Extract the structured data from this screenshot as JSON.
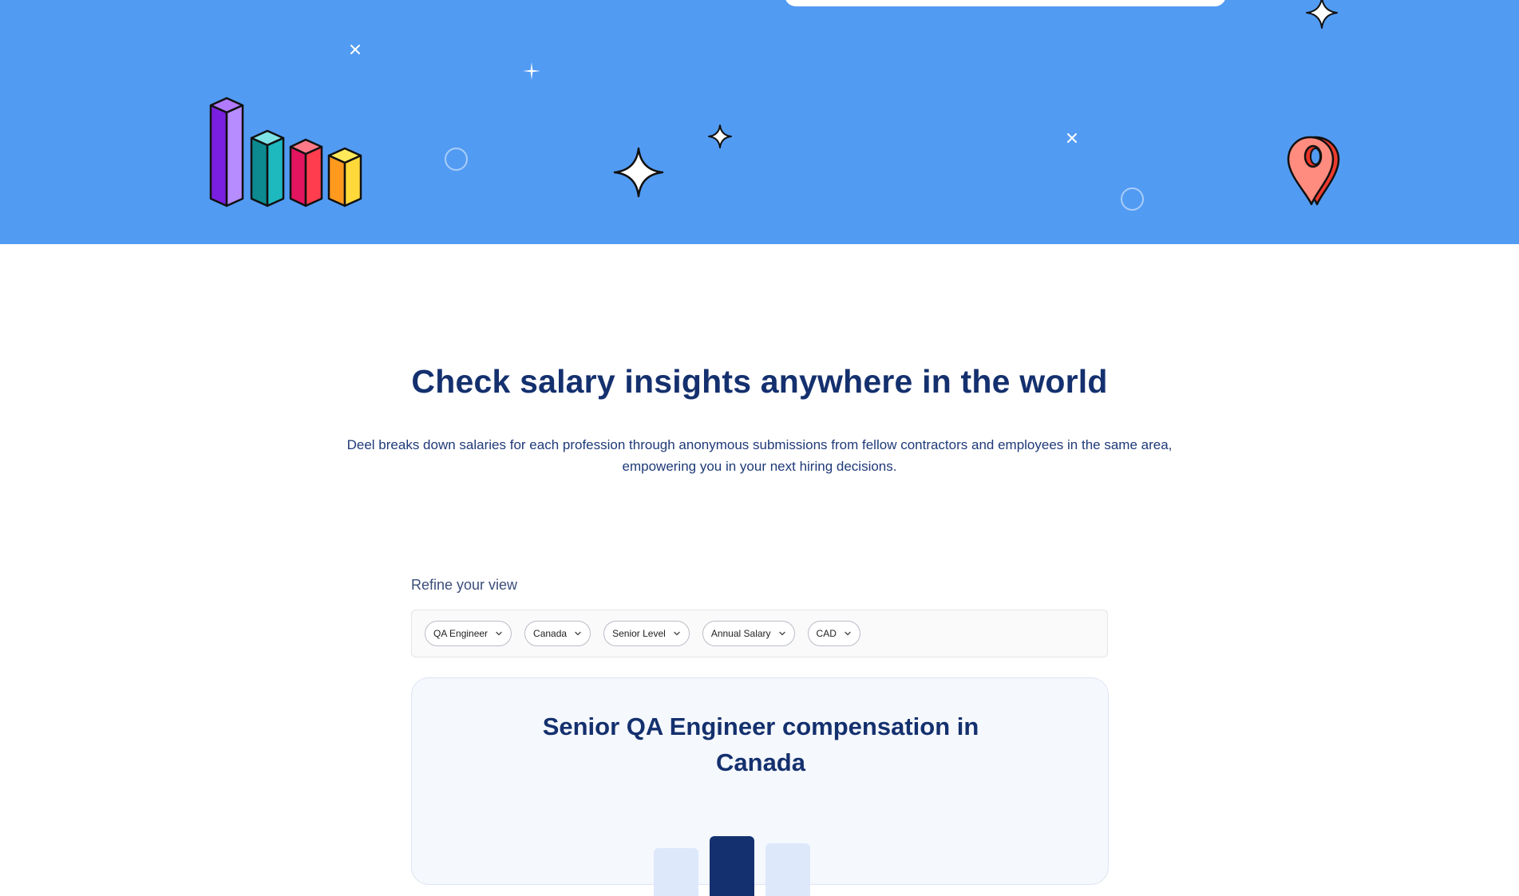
{
  "page": {
    "heading": "Check salary insights anywhere in the world",
    "description_line1": "Deel breaks down salaries for each profession through anonymous submissions from fellow contractors and employees in the same area,",
    "description_line2": "empowering you in your next hiring decisions."
  },
  "refine": {
    "label": "Refine your view",
    "filters": [
      {
        "label": "QA Engineer"
      },
      {
        "label": "Canada"
      },
      {
        "label": "Senior Level"
      },
      {
        "label": "Annual Salary"
      },
      {
        "label": "CAD"
      }
    ]
  },
  "card": {
    "title_line1": "Senior QA Engineer compensation in",
    "title_line2": "Canada"
  },
  "colors": {
    "hero_bg": "#529bf3",
    "heading": "#14306e",
    "card_bg": "#f5f8fd",
    "bar_dark": "#14306e",
    "bar_light": "#dde8fb"
  },
  "icons": [
    "bar-chart-illustration",
    "sparkle-icon",
    "cross-sparkle-icon",
    "circle-outline-icon",
    "location-pin-illustration",
    "chevron-down-icon"
  ]
}
